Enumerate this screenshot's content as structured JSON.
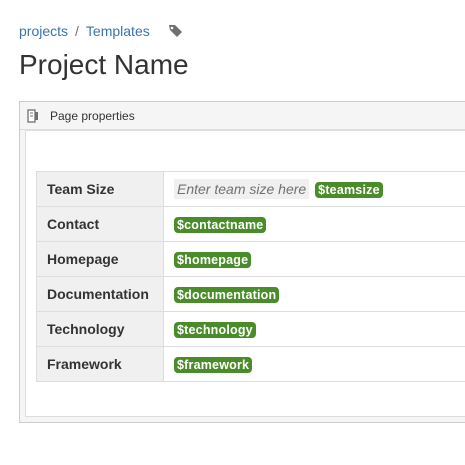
{
  "breadcrumb": {
    "items": [
      "projects",
      "Templates"
    ],
    "separator": "/"
  },
  "page": {
    "title": "Project Name"
  },
  "macro": {
    "title": "Page properties"
  },
  "properties": [
    {
      "key": "Team Size",
      "placeholder": "Enter team size here",
      "variable": "$teamsize"
    },
    {
      "key": "Contact",
      "variable": "$contactname"
    },
    {
      "key": "Homepage",
      "variable": "$homepage"
    },
    {
      "key": "Documentation",
      "variable": "$documentation"
    },
    {
      "key": "Technology",
      "variable": "$technology"
    },
    {
      "key": "Framework",
      "variable": "$framework"
    }
  ],
  "icons": {
    "tag": "tag-icon",
    "macro": "page-properties-icon"
  },
  "colors": {
    "link": "#3b73af",
    "variable_bg": "#4a8c2a",
    "key_text": "#333333"
  }
}
